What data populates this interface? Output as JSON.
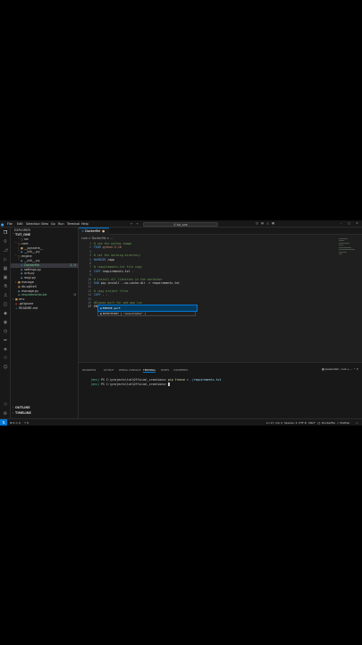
{
  "titlebar": {
    "menus": [
      "File",
      "Edit",
      "Selection",
      "View",
      "Go",
      "Run",
      "Terminal",
      "Help"
    ],
    "search_text": "tut_one"
  },
  "explorer": {
    "header": "EXPLORER",
    "root": "TUT_ONE",
    "items": [
      {
        "label": "src",
        "badge": "",
        "icon": "folder-open-icon"
      },
      {
        "label": "core",
        "badge": "",
        "icon": "folder-open-icon"
      },
      {
        "label": "__pycache__",
        "badge": "",
        "icon": "folder-icon"
      },
      {
        "label": "__init__.py",
        "badge": "",
        "icon": "python-file-icon"
      },
      {
        "label": "engine",
        "badge": "",
        "icon": "folder-open-icon"
      },
      {
        "label": "__init__.py",
        "badge": "",
        "icon": "python-file-icon"
      },
      {
        "label": "Dockerfile",
        "badge": "1, U",
        "icon": "docker-file-icon"
      },
      {
        "label": "settings.py",
        "badge": "",
        "icon": "python-file-icon"
      },
      {
        "label": "urls.py",
        "badge": "",
        "icon": "python-file-icon"
      },
      {
        "label": "wsgi.py",
        "badge": "",
        "icon": "python-file-icon"
      },
      {
        "label": "manage",
        "badge": "",
        "icon": "folder-icon"
      },
      {
        "label": "db.sqlite3",
        "badge": "",
        "icon": "database-icon"
      },
      {
        "label": "manage.py",
        "badge": "",
        "icon": "python-file-icon"
      },
      {
        "label": "requirements.txt",
        "badge": "U",
        "icon": "text-file-icon"
      },
      {
        "label": "env",
        "badge": "",
        "icon": "folder-icon"
      },
      {
        "label": ".gitignore",
        "badge": "",
        "icon": "git-file-icon"
      },
      {
        "label": "README.md",
        "badge": "",
        "icon": "markdown-file-icon"
      }
    ],
    "outline": "OUTLINE",
    "timeline": "TIMELINE"
  },
  "editor": {
    "tab_label": "Dockerfile",
    "breadcrumb": "core > Dockerfile > ...",
    "lines": [
      {
        "n": "1",
        "parts": [
          {
            "t": "# use the python image",
            "c": "c-comment"
          }
        ]
      },
      {
        "n": "2",
        "parts": [
          {
            "t": "FROM ",
            "c": "c-kw"
          },
          {
            "t": "python:3.10",
            "c": "c-str"
          }
        ]
      },
      {
        "n": "3",
        "parts": []
      },
      {
        "n": "4",
        "parts": [
          {
            "t": "# set the working directory",
            "c": "c-comment"
          }
        ]
      },
      {
        "n": "5",
        "parts": [
          {
            "t": "WORKDIR ",
            "c": "c-kw"
          },
          {
            "t": "/app",
            "c": "c-plain"
          }
        ]
      },
      {
        "n": "6",
        "parts": []
      },
      {
        "n": "7",
        "parts": [
          {
            "t": "# requirements.txt file copy",
            "c": "c-comment"
          }
        ]
      },
      {
        "n": "8",
        "parts": [
          {
            "t": "COPY ",
            "c": "c-kw"
          },
          {
            "t": "requirements.txt .",
            "c": "c-plain"
          }
        ]
      },
      {
        "n": "9",
        "parts": []
      },
      {
        "n": "10",
        "parts": [
          {
            "t": "# Install all libraries in the container",
            "c": "c-comment"
          }
        ]
      },
      {
        "n": "11",
        "parts": [
          {
            "t": "RUN ",
            "c": "c-kw"
          },
          {
            "t": "pip install --no-cache-dir -r requirements.txt",
            "c": "c-plain"
          }
        ]
      },
      {
        "n": "12",
        "parts": []
      },
      {
        "n": "13",
        "parts": [
          {
            "t": "# copy project files",
            "c": "c-comment"
          }
        ]
      },
      {
        "n": "14",
        "parts": [
          {
            "t": "COPY ",
            "c": "c-kw"
          },
          {
            "t": ". .",
            "c": "c-plain"
          }
        ]
      },
      {
        "n": "15",
        "parts": []
      },
      {
        "n": "16",
        "parts": [
          {
            "t": "#Expose port for web app run",
            "c": "c-comment"
          }
        ]
      },
      {
        "n": "17",
        "parts": [
          {
            "t": "ENX",
            "c": "c-plain"
          }
        ]
      }
    ],
    "suggestions": [
      {
        "label": "EXPOSE port",
        "icon": "snippet-icon"
      },
      {
        "label": "ENTRYPOINT [ \"executable\" ]",
        "icon": "snippet-icon"
      }
    ]
  },
  "panel": {
    "tabs": [
      "PROBLEMS",
      "OUTPUT",
      "DEBUG CONSOLE",
      "TERMINAL",
      "PORTS",
      "COMMENTS"
    ],
    "active_tab": "TERMINAL",
    "terminal_label": "powershell - core",
    "lines": [
      {
        "venv": "(env)",
        "prompt": " PS C:\\projects\\tut\\Official_creations> ",
        "cmd": "pip freeze",
        "args": " > ./requirements.txt"
      },
      {
        "venv": "(env)",
        "prompt": " PS C:\\projects\\tut\\Official_creations> ",
        "cmd": "",
        "args": ""
      }
    ]
  },
  "statusbar": {
    "problems": "⊗ 0 ⚠ 0",
    "ports": "⚡ 0",
    "cursor": "Ln 17, Col 4",
    "spaces": "Spaces: 4",
    "encoding": "UTF-8",
    "eol": "CRLF",
    "language": "{} Dockerfile",
    "prettier": "✓ Prettier"
  }
}
